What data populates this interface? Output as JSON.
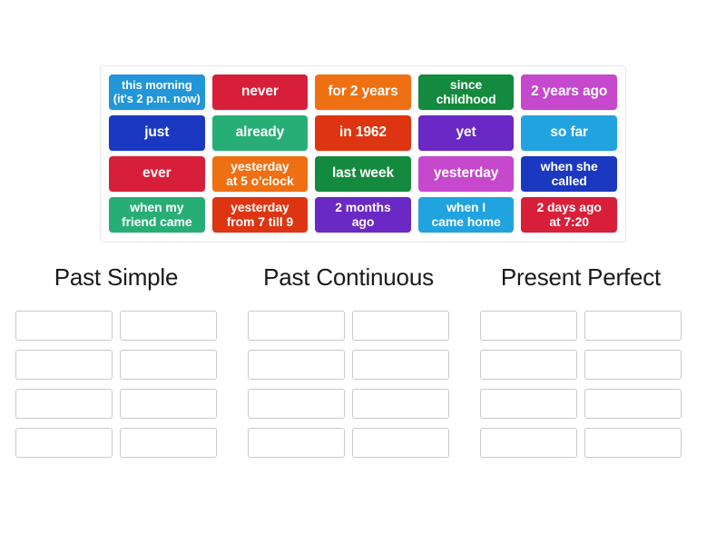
{
  "activity": {
    "type": "group-sort",
    "tile_text_color": "#ffffff"
  },
  "tile_pool": {
    "name": "draggable-word-tiles",
    "rows": [
      [
        {
          "label": "this morning\n(it's 2 p.m. now)",
          "color": "#2196d8",
          "lines": [
            "this morning",
            "(it's 2 p.m. now)"
          ]
        },
        {
          "label": "never",
          "color": "#d81f3a",
          "lines": [
            "never"
          ]
        },
        {
          "label": "for 2 years",
          "color": "#ef7012",
          "lines": [
            "for 2 years"
          ]
        },
        {
          "label": "since childhood",
          "color": "#138a3e",
          "lines": [
            "since",
            "childhood"
          ]
        },
        {
          "label": "2 years ago",
          "color": "#c548cd",
          "lines": [
            "2 years ago"
          ]
        }
      ],
      [
        {
          "label": "just",
          "color": "#1b39c0",
          "lines": [
            "just"
          ]
        },
        {
          "label": "already",
          "color": "#27ae76",
          "lines": [
            "already"
          ]
        },
        {
          "label": "in 1962",
          "color": "#dd3511",
          "lines": [
            "in 1962"
          ]
        },
        {
          "label": "yet",
          "color": "#6a28c4",
          "lines": [
            "yet"
          ]
        },
        {
          "label": "so far",
          "color": "#21a3e0",
          "lines": [
            "so far"
          ]
        }
      ],
      [
        {
          "label": "ever",
          "color": "#d81f3a",
          "lines": [
            "ever"
          ]
        },
        {
          "label": "yesterday at 5 o'clock",
          "color": "#ef7012",
          "lines": [
            "yesterday",
            "at 5 o'clock"
          ]
        },
        {
          "label": "last week",
          "color": "#138a3e",
          "lines": [
            "last week"
          ]
        },
        {
          "label": "yesterday",
          "color": "#c548cd",
          "lines": [
            "yesterday"
          ]
        },
        {
          "label": "when she called",
          "color": "#1b39c0",
          "lines": [
            "when she",
            "called"
          ]
        }
      ],
      [
        {
          "label": "when my friend came",
          "color": "#27ae76",
          "lines": [
            "when my",
            "friend came"
          ]
        },
        {
          "label": "yesterday from 7 till 9",
          "color": "#dd3511",
          "lines": [
            "yesterday",
            "from 7 till 9"
          ]
        },
        {
          "label": "2 months ago",
          "color": "#6a28c4",
          "lines": [
            "2 months",
            "ago"
          ]
        },
        {
          "label": "when I came home",
          "color": "#21a3e0",
          "lines": [
            "when I",
            "came home"
          ]
        },
        {
          "label": "2 days ago at 7:20",
          "color": "#d81f3a",
          "lines": [
            "2 days ago",
            "at 7:20"
          ]
        }
      ]
    ]
  },
  "columns": [
    {
      "title": "Past Simple",
      "slots": [
        "",
        "",
        "",
        "",
        "",
        "",
        "",
        ""
      ]
    },
    {
      "title": "Past Continuous",
      "slots": [
        "",
        "",
        "",
        "",
        "",
        "",
        "",
        ""
      ]
    },
    {
      "title": "Present Perfect",
      "slots": [
        "",
        "",
        "",
        "",
        "",
        "",
        "",
        ""
      ]
    }
  ]
}
